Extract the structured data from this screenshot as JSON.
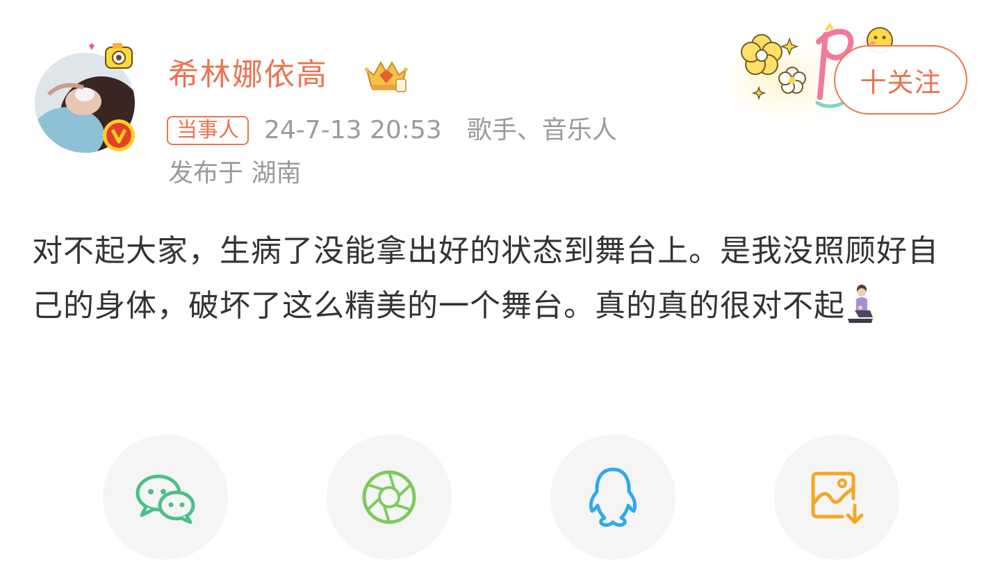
{
  "user": {
    "name": "希林娜依高",
    "tag": "当事人",
    "timestamp": "24-7-13 20:53",
    "source": "歌手、音乐人",
    "location": "发布于 湖南"
  },
  "follow": {
    "label": "十关注"
  },
  "post": {
    "text": "对不起大家，生病了没能拿出好的状态到舞台上。是我没照顾好自己的身体，破坏了这么精美的一个舞台。真的真的很对不起",
    "emoji": "kneeling-person-emoji"
  },
  "share": {
    "items": [
      {
        "name": "wechat",
        "icon": "wechat-icon",
        "color": "#4cbf8b"
      },
      {
        "name": "moments",
        "icon": "moments-aperture-icon",
        "color": "#7dcb5a"
      },
      {
        "name": "qq",
        "icon": "qq-penguin-icon",
        "color": "#30a8ec"
      },
      {
        "name": "save-image",
        "icon": "save-image-icon",
        "color": "#f5a623"
      }
    ]
  },
  "colors": {
    "accent": "#eb7350",
    "meta_gray": "#9a9a9a",
    "text": "#333333",
    "share_bg": "#f5f5f5"
  }
}
